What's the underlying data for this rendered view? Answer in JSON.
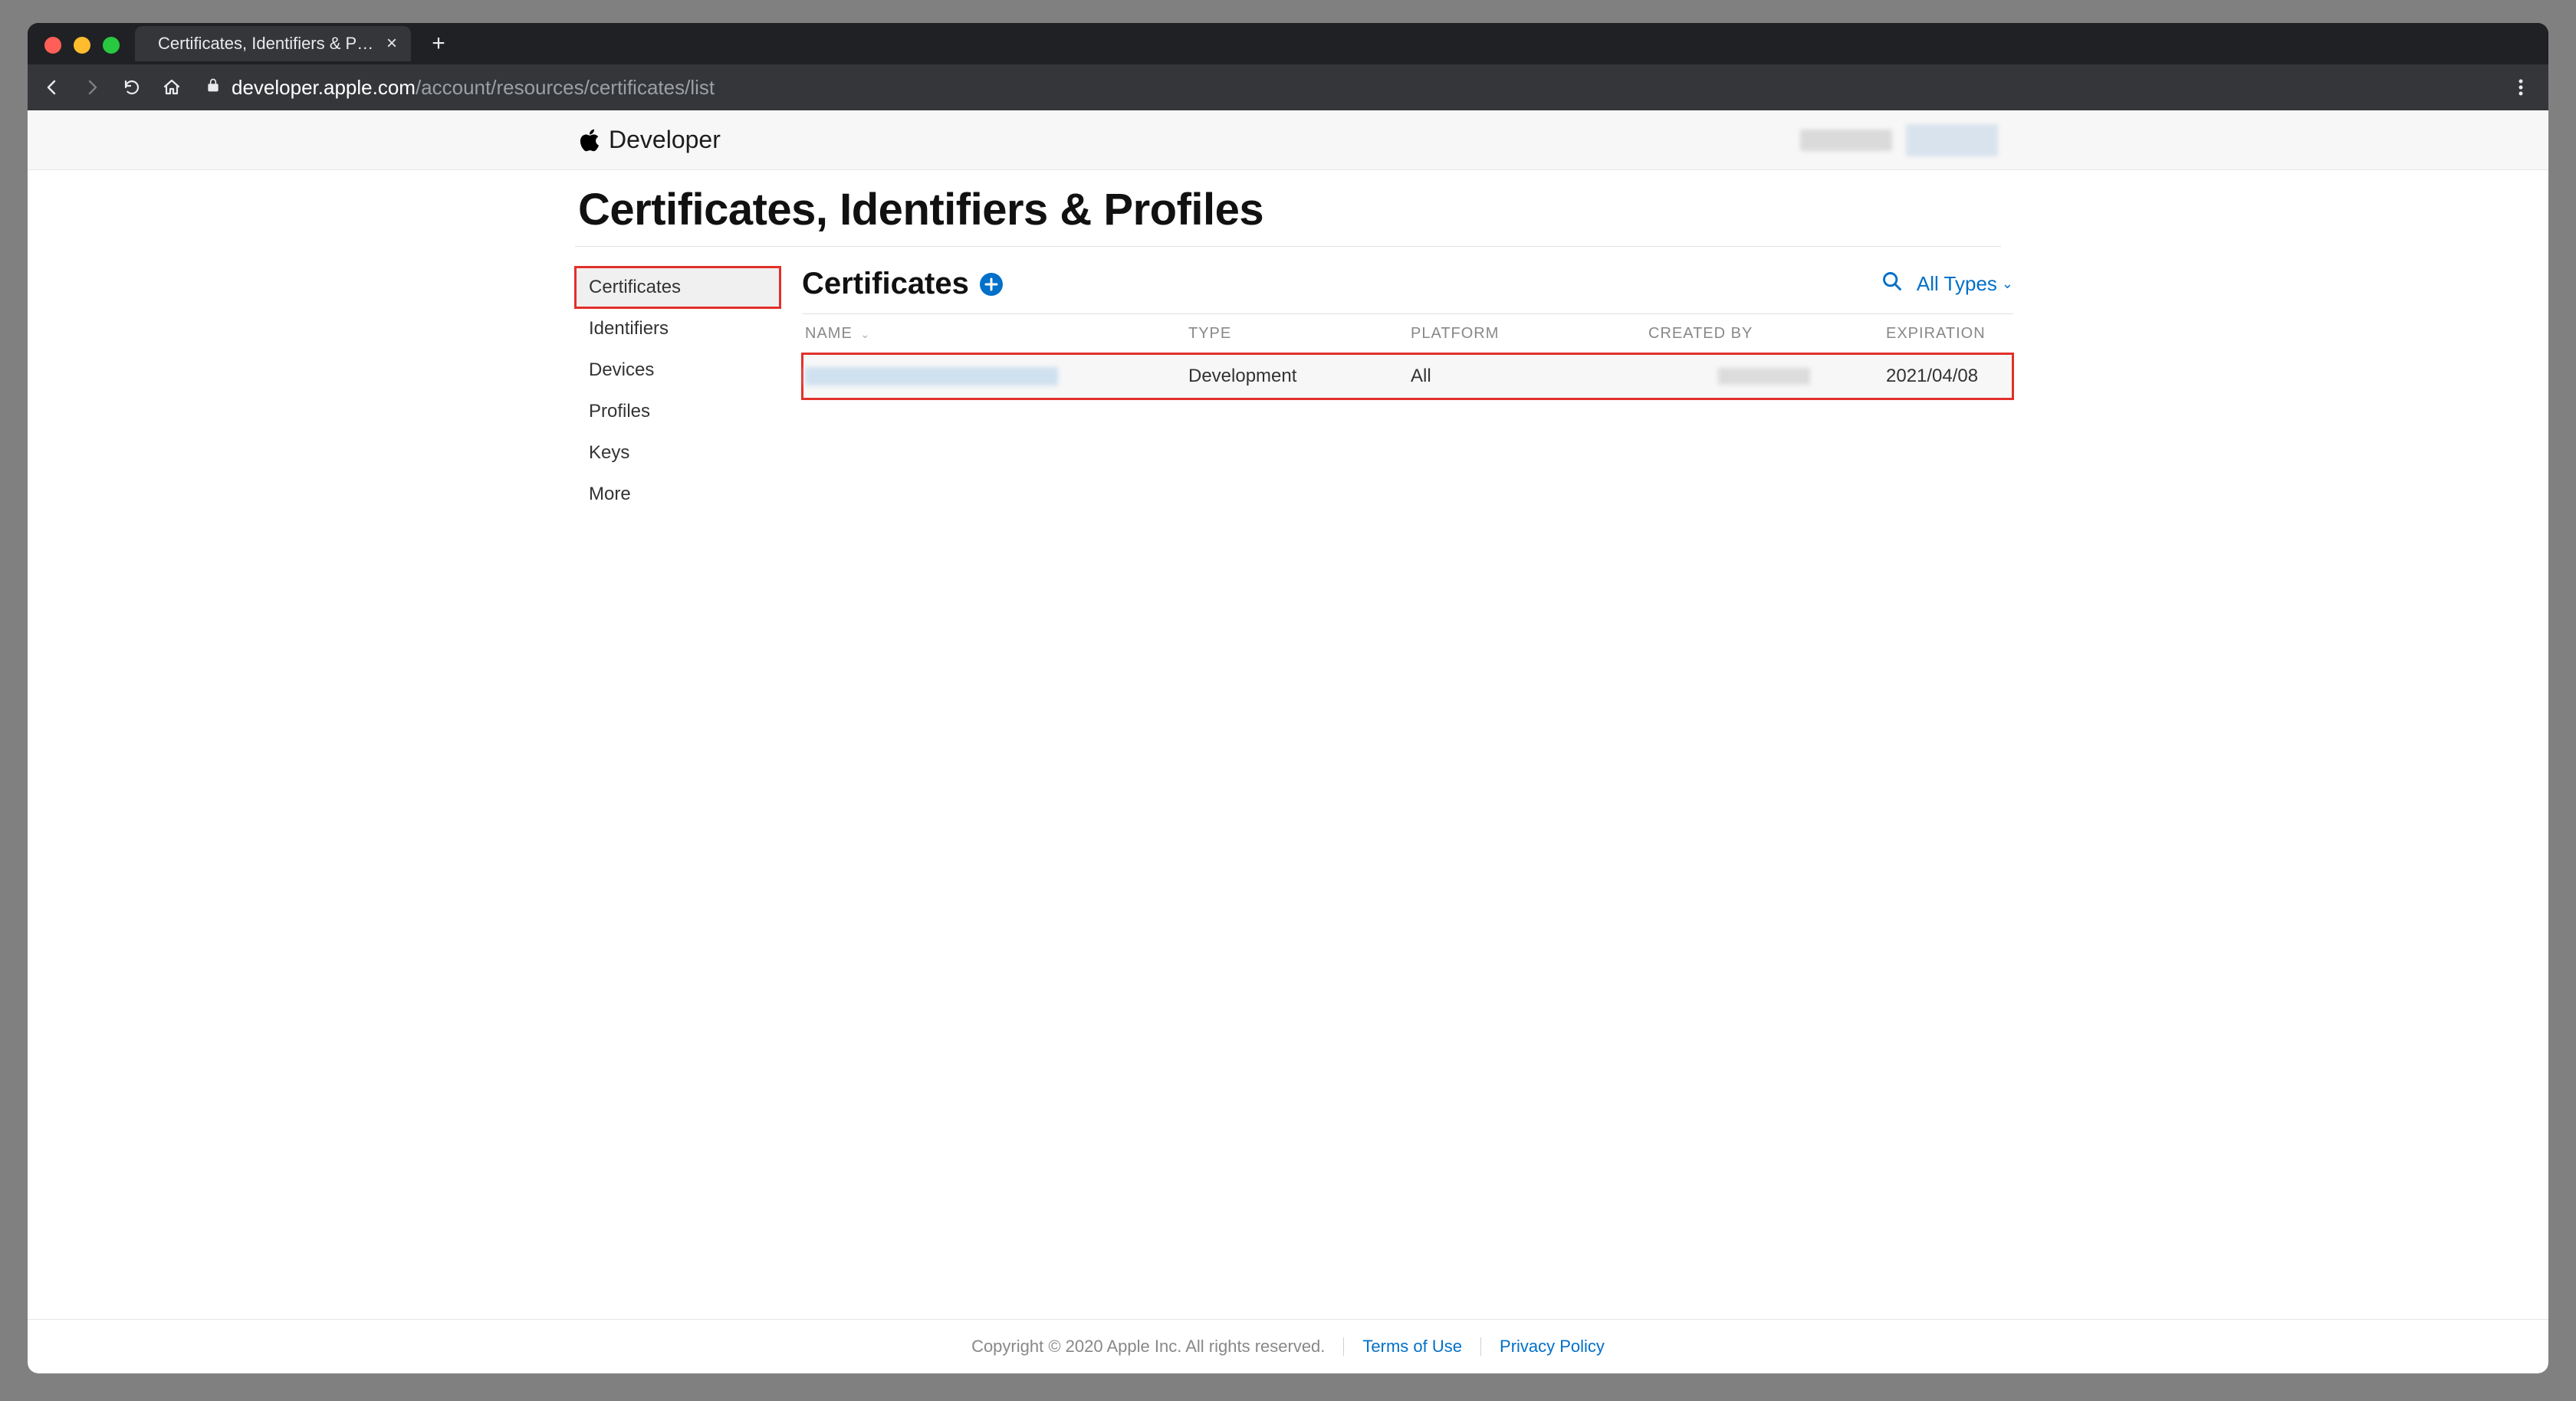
{
  "browser": {
    "tab_title": "Certificates, Identifiers & Profiles",
    "url_host": "developer.apple.com",
    "url_path": "/account/resources/certificates/list"
  },
  "header": {
    "brand_label": "Developer"
  },
  "page": {
    "title": "Certificates, Identifiers & Profiles"
  },
  "sidebar": {
    "items": [
      {
        "label": "Certificates",
        "active": true
      },
      {
        "label": "Identifiers",
        "active": false
      },
      {
        "label": "Devices",
        "active": false
      },
      {
        "label": "Profiles",
        "active": false
      },
      {
        "label": "Keys",
        "active": false
      },
      {
        "label": "More",
        "active": false
      }
    ]
  },
  "section": {
    "title": "Certificates",
    "filter_label": "All Types"
  },
  "table": {
    "columns": {
      "name": "NAME",
      "type": "TYPE",
      "platform": "PLATFORM",
      "created_by": "CREATED BY",
      "expiration": "EXPIRATION"
    },
    "rows": [
      {
        "name": "",
        "type": "Development",
        "platform": "All",
        "created_by": "",
        "expiration": "2021/04/08"
      }
    ]
  },
  "footer": {
    "copyright": "Copyright © 2020 Apple Inc. All rights reserved.",
    "terms": "Terms of Use",
    "privacy": "Privacy Policy"
  }
}
